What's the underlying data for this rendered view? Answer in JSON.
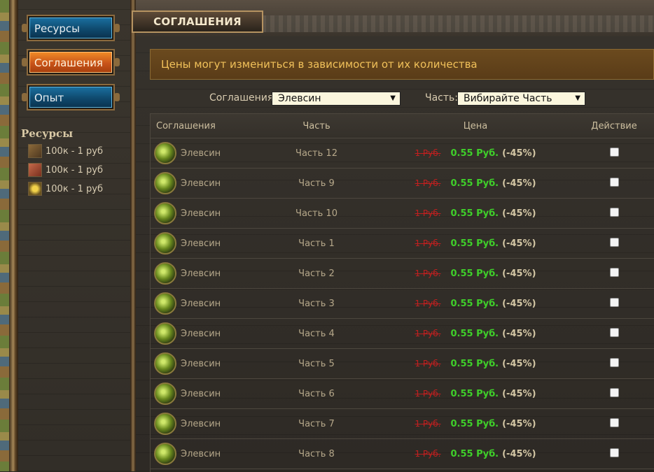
{
  "sidebar": {
    "nav": [
      {
        "label": "Ресурсы",
        "active": false
      },
      {
        "label": "Соглашения",
        "active": true
      },
      {
        "label": "Опыт",
        "active": false
      }
    ],
    "resources_title": "Ресурсы",
    "resources": [
      {
        "icon": "wood-icon",
        "text": "100к - 1 руб"
      },
      {
        "icon": "brick-icon",
        "text": "100к - 1 руб"
      },
      {
        "icon": "gold-icon",
        "text": "100к - 1 руб"
      }
    ]
  },
  "header": {
    "tab_label": "СОГЛАШЕНИЯ"
  },
  "notice": "Цены могут измениться в зависимости от их количества",
  "filters": {
    "agreement_label": "Соглашения:",
    "agreement_value": "Элевсин",
    "part_label": "Часть:",
    "part_value": "Вибирайте Часть"
  },
  "table": {
    "headers": [
      "Соглашения",
      "Часть",
      "Цена",
      "Действие"
    ],
    "rows": [
      {
        "name": "Элевсин",
        "part": "Часть 12",
        "old_price": "1 Руб.",
        "new_price": "0.55 Руб.",
        "discount": "(-45%)"
      },
      {
        "name": "Элевсин",
        "part": "Часть 9",
        "old_price": "1 Руб.",
        "new_price": "0.55 Руб.",
        "discount": "(-45%)"
      },
      {
        "name": "Элевсин",
        "part": "Часть 10",
        "old_price": "1 Руб.",
        "new_price": "0.55 Руб.",
        "discount": "(-45%)"
      },
      {
        "name": "Элевсин",
        "part": "Часть 1",
        "old_price": "1 Руб.",
        "new_price": "0.55 Руб.",
        "discount": "(-45%)"
      },
      {
        "name": "Элевсин",
        "part": "Часть 2",
        "old_price": "1 Руб.",
        "new_price": "0.55 Руб.",
        "discount": "(-45%)"
      },
      {
        "name": "Элевсин",
        "part": "Часть 3",
        "old_price": "1 Руб.",
        "new_price": "0.55 Руб.",
        "discount": "(-45%)"
      },
      {
        "name": "Элевсин",
        "part": "Часть 4",
        "old_price": "1 Руб.",
        "new_price": "0.55 Руб.",
        "discount": "(-45%)"
      },
      {
        "name": "Элевсин",
        "part": "Часть 5",
        "old_price": "1 Руб.",
        "new_price": "0.55 Руб.",
        "discount": "(-45%)"
      },
      {
        "name": "Элевсин",
        "part": "Часть 6",
        "old_price": "1 Руб.",
        "new_price": "0.55 Руб.",
        "discount": "(-45%)"
      },
      {
        "name": "Элевсин",
        "part": "Часть 7",
        "old_price": "1 Руб.",
        "new_price": "0.55 Руб.",
        "discount": "(-45%)"
      },
      {
        "name": "Элевсин",
        "part": "Часть 8",
        "old_price": "1 Руб.",
        "new_price": "0.55 Руб.",
        "discount": "(-45%)"
      }
    ]
  },
  "colors": {
    "accent_orange": "#c9541a",
    "nav_blue": "#0f4a6e",
    "price_green": "#3fcf2a",
    "old_price_red": "#c21f1f",
    "notice_text": "#f1c15a"
  }
}
